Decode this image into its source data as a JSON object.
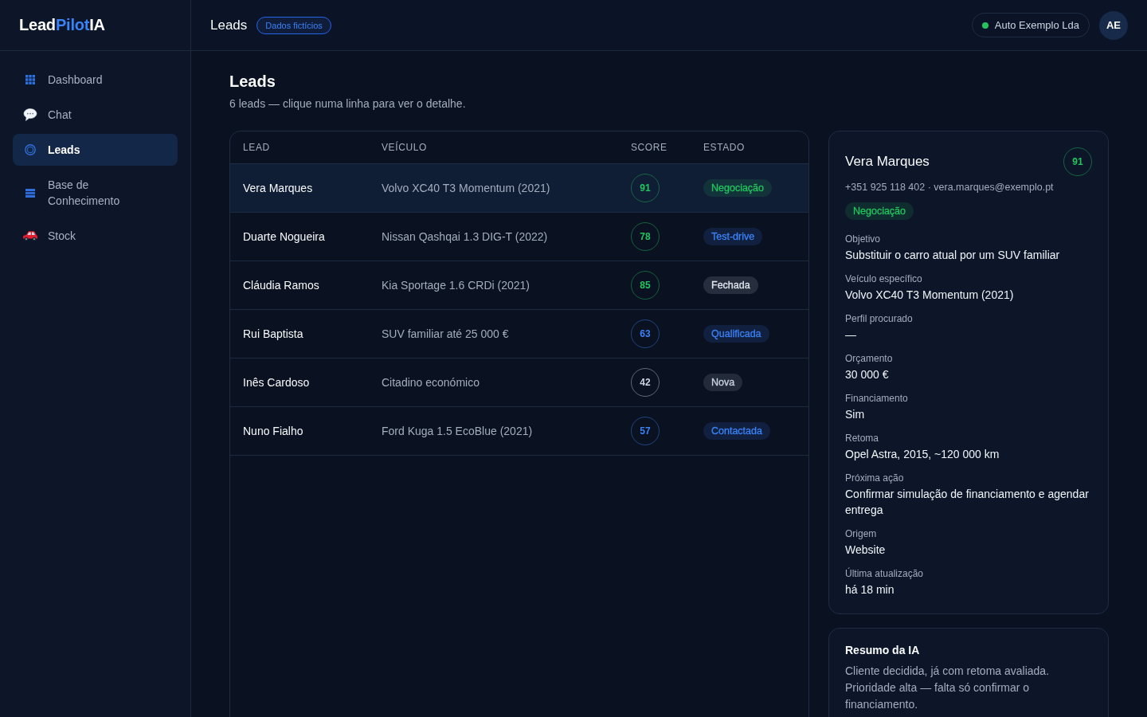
{
  "logo": {
    "parts": [
      {
        "text": "Lead",
        "accent": false
      },
      {
        "text": "Pilot",
        "accent": true
      },
      {
        "text": "IA",
        "accent": false
      }
    ]
  },
  "topbar": {
    "title": "Leads",
    "badge": "Dados fictícios",
    "account": {
      "name": "Auto Exemplo Lda",
      "online": true
    },
    "avatar": "AE"
  },
  "sidebar": {
    "items": [
      {
        "label": "Dashboard",
        "selected": false
      },
      {
        "label": "Chat",
        "selected": false
      },
      {
        "label": "Leads",
        "selected": true
      },
      {
        "label": "Base de Conhecimento",
        "selected": false
      },
      {
        "label": "Stock",
        "selected": false
      }
    ]
  },
  "page": {
    "title": "Leads",
    "subtitle": "6 leads — clique numa linha para ver o detalhe."
  },
  "table": {
    "columns": [
      "LEAD",
      "VEÍCULO",
      "SCORE",
      "ESTADO"
    ],
    "rows": [
      {
        "lead": "Vera Marques",
        "vehicle": "Volvo XC40 T3 Momentum (2021)",
        "score": {
          "value": "91",
          "color": "#22c55e"
        },
        "status": {
          "label": "Negociação",
          "color": "#22c55e"
        },
        "selected": true
      },
      {
        "lead": "Duarte Nogueira",
        "vehicle": "Nissan Qashqai 1.3 DIG-T (2022)",
        "score": {
          "value": "78",
          "color": "#22c55e"
        },
        "status": {
          "label": "Test-drive",
          "color": "#3b82f6"
        },
        "selected": false
      },
      {
        "lead": "Cláudia Ramos",
        "vehicle": "Kia Sportage 1.6 CRDi (2021)",
        "score": {
          "value": "85",
          "color": "#22c55e"
        },
        "status": {
          "label": "Fechada",
          "color": "#e2e8f0"
        },
        "selected": false
      },
      {
        "lead": "Rui Baptista",
        "vehicle": "SUV familiar até 25 000 €",
        "score": {
          "value": "63",
          "color": "#3b82f6"
        },
        "status": {
          "label": "Qualificada",
          "color": "#3b82f6"
        },
        "selected": false
      },
      {
        "lead": "Inês Cardoso",
        "vehicle": "Citadino económico",
        "score": {
          "value": "42",
          "color": "#cbd5e1"
        },
        "status": {
          "label": "Nova",
          "color": "#cbd5e1"
        },
        "selected": false
      },
      {
        "lead": "Nuno Fialho",
        "vehicle": "Ford Kuga 1.5 EcoBlue (2021)",
        "score": {
          "value": "57",
          "color": "#3b82f6"
        },
        "status": {
          "label": "Contactada",
          "color": "#3b82f6"
        },
        "selected": false
      }
    ]
  },
  "detail": {
    "name": "Vera Marques",
    "score": {
      "value": "91",
      "color": "#22c55e"
    },
    "contact": "+351 925 118 402 · vera.marques@exemplo.pt",
    "status": {
      "label": "Negociação",
      "color": "#22c55e"
    },
    "fields": [
      {
        "label": "Objetivo",
        "value": "Substituir o carro atual por um SUV familiar"
      },
      {
        "label": "Veículo específico",
        "value": "Volvo XC40 T3 Momentum (2021)"
      },
      {
        "label": "Perfil procurado",
        "value": "—"
      },
      {
        "label": "Orçamento",
        "value": "30 000 €"
      },
      {
        "label": "Financiamento",
        "value": "Sim"
      },
      {
        "label": "Retoma",
        "value": "Opel Astra, 2015, ~120 000 km"
      },
      {
        "label": "Próxima ação",
        "value": "Confirmar simulação de financiamento e agendar entrega"
      },
      {
        "label": "Origem",
        "value": "Website"
      },
      {
        "label": "Última atualização",
        "value": "há 18 min"
      }
    ]
  },
  "summary": {
    "title": "Resumo da IA",
    "text": "Cliente decidida, já com retoma avaliada. Prioridade alta — falta só confirmar o financiamento."
  }
}
